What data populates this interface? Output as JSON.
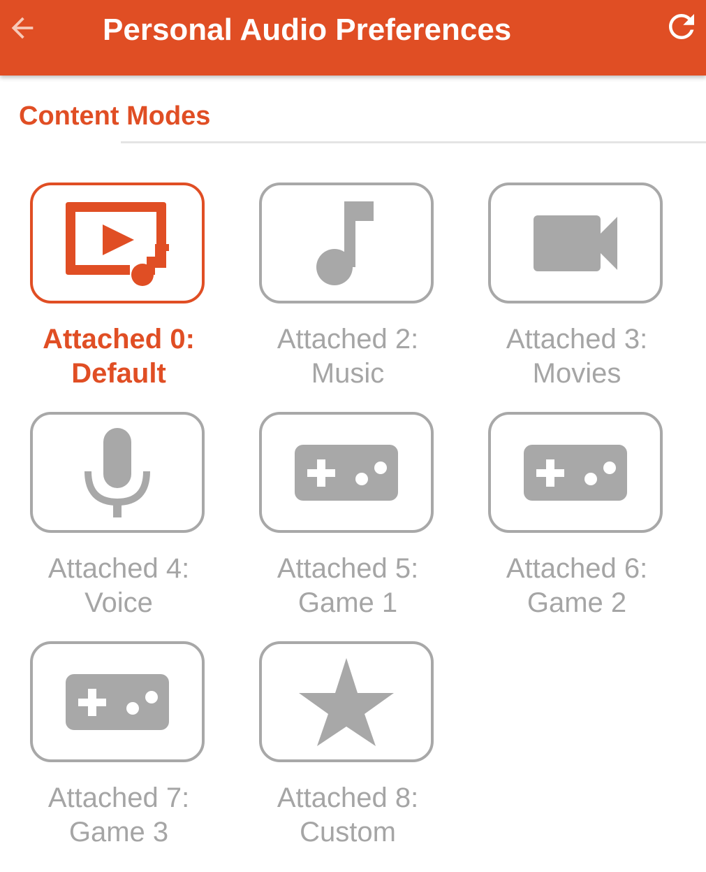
{
  "app": {
    "title": "Personal Audio Preferences",
    "back_icon": "arrow-back-icon",
    "refresh_icon": "refresh-icon",
    "accent_color": "#e04e24",
    "inactive_color": "#a8a8a8"
  },
  "section": {
    "title": "Content Modes"
  },
  "modes": [
    {
      "line1": "Attached 0:",
      "line2": "Default",
      "icon": "video-music-icon",
      "selected": true
    },
    {
      "line1": "Attached 2:",
      "line2": "Music",
      "icon": "music-note-icon",
      "selected": false
    },
    {
      "line1": "Attached 3:",
      "line2": "Movies",
      "icon": "videocam-icon",
      "selected": false
    },
    {
      "line1": "Attached 4:",
      "line2": "Voice",
      "icon": "microphone-icon",
      "selected": false
    },
    {
      "line1": "Attached 5:",
      "line2": "Game 1",
      "icon": "gamepad-icon",
      "selected": false
    },
    {
      "line1": "Attached 6:",
      "line2": "Game 2",
      "icon": "gamepad-icon",
      "selected": false
    },
    {
      "line1": "Attached 7:",
      "line2": "Game 3",
      "icon": "gamepad-icon",
      "selected": false
    },
    {
      "line1": "Attached 8:",
      "line2": "Custom",
      "icon": "star-icon",
      "selected": false
    }
  ]
}
